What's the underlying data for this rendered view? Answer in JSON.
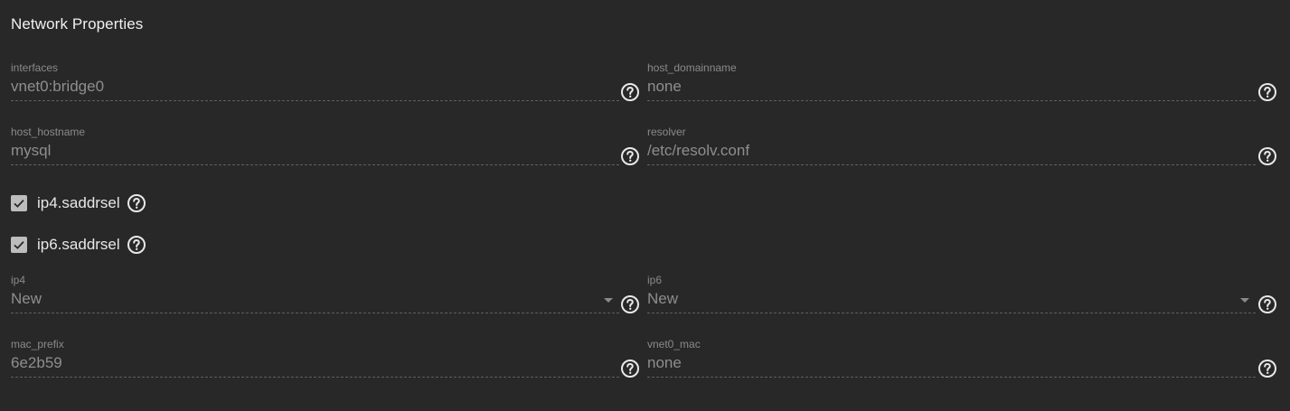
{
  "section": {
    "title": "Network Properties"
  },
  "icons": {
    "help": "help-circle-icon",
    "check": "checkmark-icon",
    "dropdown": "triangle-down-icon"
  },
  "colors": {
    "background": "#282828",
    "label": "#8a8a8a",
    "value": "#8e8e8e",
    "checkbox": "#bdbdbd",
    "icon": "#e8e8e8"
  },
  "fields": {
    "interfaces": {
      "label": "interfaces",
      "value": "vnet0:bridge0"
    },
    "host_domainname": {
      "label": "host_domainname",
      "value": "none"
    },
    "host_hostname": {
      "label": "host_hostname",
      "value": "mysql"
    },
    "resolver": {
      "label": "resolver",
      "value": "/etc/resolv.conf"
    },
    "ip4": {
      "label": "ip4",
      "value": "New"
    },
    "ip6": {
      "label": "ip6",
      "value": "New"
    },
    "mac_prefix": {
      "label": "mac_prefix",
      "value": "6e2b59"
    },
    "vnet0_mac": {
      "label": "vnet0_mac",
      "value": "none"
    }
  },
  "checkboxes": {
    "ip4_saddrsel": {
      "label": "ip4.saddrsel",
      "checked": true
    },
    "ip6_saddrsel": {
      "label": "ip6.saddrsel",
      "checked": true
    }
  }
}
